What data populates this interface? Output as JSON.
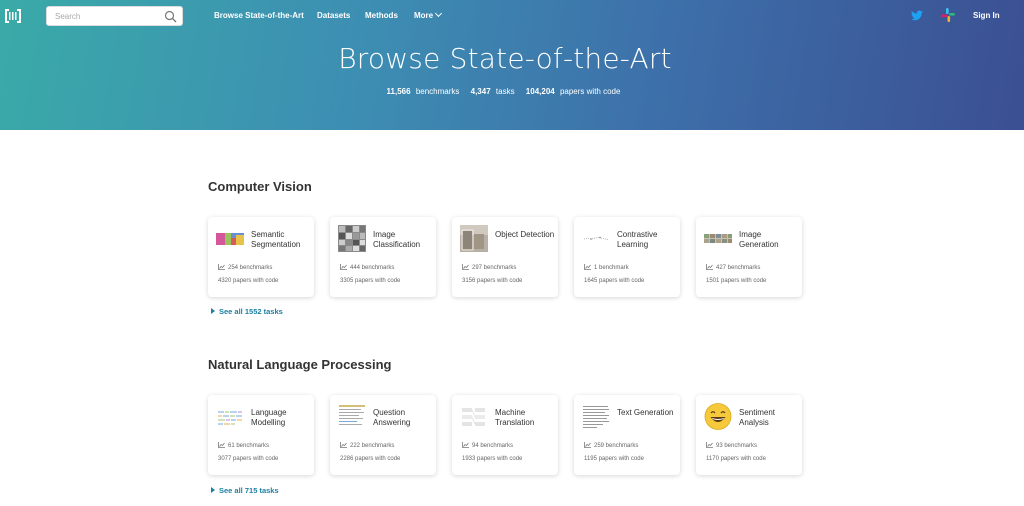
{
  "header": {
    "search_placeholder": "Search",
    "nav": [
      "Browse State-of-the-Art",
      "Datasets",
      "Methods",
      "More"
    ],
    "signin": "Sign In"
  },
  "hero": {
    "title": "Browse State-of-the-Art",
    "benchmarks_count": "11,566",
    "benchmarks_label": "benchmarks",
    "tasks_count": "4,347",
    "tasks_label": "tasks",
    "papers_count": "104,204",
    "papers_label": "papers with code"
  },
  "sections": [
    {
      "title": "Computer Vision",
      "see_all": "See all 1552 tasks",
      "cards": [
        {
          "title": "Semantic Segmentation",
          "benchmarks": "254 benchmarks",
          "papers": "4320 papers with code",
          "thumb": "segmentation-thumbnail"
        },
        {
          "title": "Image Classification",
          "benchmarks": "444 benchmarks",
          "papers": "3305 papers with code",
          "thumb": "classification-thumbnail"
        },
        {
          "title": "Object Detection",
          "benchmarks": "297 benchmarks",
          "papers": "3156 papers with code",
          "thumb": "detection-thumbnail"
        },
        {
          "title": "Contrastive Learning",
          "benchmarks": "1 benchmark",
          "papers": "1645 papers with code",
          "thumb": "contrastive-thumbnail"
        },
        {
          "title": "Image Generation",
          "benchmarks": "427 benchmarks",
          "papers": "1501 papers with code",
          "thumb": "generation-thumbnail"
        }
      ]
    },
    {
      "title": "Natural Language Processing",
      "see_all": "See all 715 tasks",
      "cards": [
        {
          "title": "Language Modelling",
          "benchmarks": "61 benchmarks",
          "papers": "3077 papers with code",
          "thumb": "language-modelling-thumbnail"
        },
        {
          "title": "Question Answering",
          "benchmarks": "222 benchmarks",
          "papers": "2286 papers with code",
          "thumb": "qa-thumbnail"
        },
        {
          "title": "Machine Translation",
          "benchmarks": "94 benchmarks",
          "papers": "1933 papers with code",
          "thumb": "translation-thumbnail"
        },
        {
          "title": "Text Generation",
          "benchmarks": "259 benchmarks",
          "papers": "1195 papers with code",
          "thumb": "text-generation-thumbnail"
        },
        {
          "title": "Sentiment Analysis",
          "benchmarks": "93 benchmarks",
          "papers": "1170 papers with code",
          "thumb": "smiley-emoji-thumbnail"
        }
      ]
    }
  ],
  "colors": {
    "hero_gradient_start": "#3aaaa8",
    "hero_gradient_end": "#3b4f92",
    "link": "#1b7ea3",
    "twitter": "#1da1f2"
  }
}
